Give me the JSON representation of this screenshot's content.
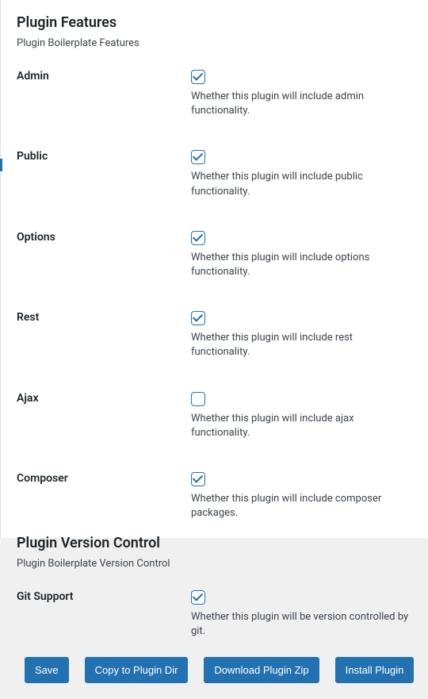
{
  "sections": {
    "features": {
      "title": "Plugin Features",
      "desc": "Plugin Boilerplate Features",
      "fields": {
        "admin": {
          "label": "Admin",
          "checked": true,
          "help": "Whether this plugin will include admin functionality."
        },
        "public": {
          "label": "Public",
          "checked": true,
          "help": "Whether this plugin will include public functionality."
        },
        "options": {
          "label": "Options",
          "checked": true,
          "help": "Whether this plugin will include options functionality."
        },
        "rest": {
          "label": "Rest",
          "checked": true,
          "help": "Whether this plugin will include rest functionality."
        },
        "ajax": {
          "label": "Ajax",
          "checked": false,
          "help": "Whether this plugin will include ajax functionality."
        },
        "composer": {
          "label": "Composer",
          "checked": true,
          "help": "Whether this plugin will include composer packages."
        }
      }
    },
    "version_control": {
      "title": "Plugin Version Control",
      "desc": "Plugin Boilerplate Version Control",
      "fields": {
        "git": {
          "label": "Git Support",
          "checked": true,
          "help": "Whether this plugin will be version controlled by git."
        }
      }
    }
  },
  "buttons": {
    "save": "Save",
    "copy": "Copy to Plugin Dir",
    "download": "Download Plugin Zip",
    "install": "Install Plugin"
  }
}
